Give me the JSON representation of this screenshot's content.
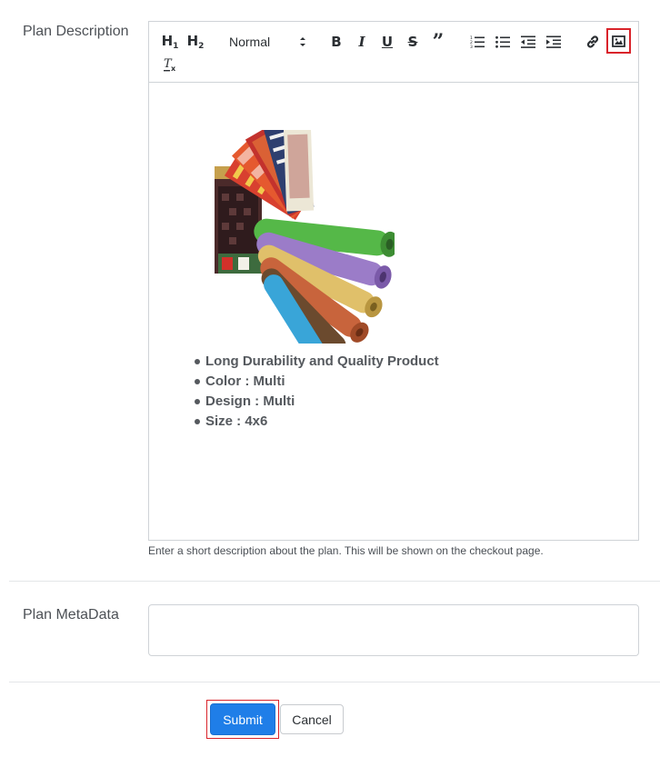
{
  "plan_description": {
    "label": "Plan Description",
    "toolbar": {
      "h1": "H",
      "h2": "H",
      "heading_picker": "Normal",
      "icons": [
        "h1-icon",
        "h2-icon",
        "bold-icon",
        "italic-icon",
        "underline-icon",
        "strikethrough-icon",
        "blockquote-icon",
        "ordered-list-icon",
        "bullet-list-icon",
        "outdent-icon",
        "indent-icon",
        "link-icon",
        "image-icon",
        "clear-format-icon"
      ]
    },
    "content": {
      "features": [
        "Long Durability and Quality Product",
        "Color : Multi",
        "Design : Multi",
        "Size : 4x6"
      ]
    },
    "help_text": "Enter a short description about the plan. This will be shown on the checkout page."
  },
  "plan_metadata": {
    "label": "Plan MetaData",
    "value": ""
  },
  "actions": {
    "submit": "Submit",
    "cancel": "Cancel"
  },
  "colors": {
    "primary": "#1f7ee8",
    "highlight": "#d9232a",
    "border": "#cfd3d7"
  }
}
